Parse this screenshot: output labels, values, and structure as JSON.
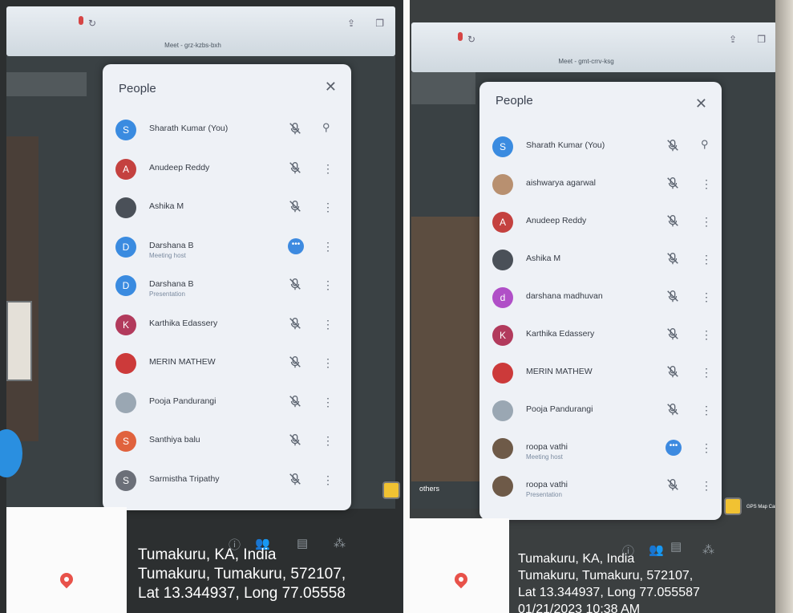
{
  "left": {
    "url": "Meet - grz-kzbs-bxh",
    "panel_title": "People",
    "participants": [
      {
        "name": "Sharath Kumar (You)",
        "initial": "S",
        "color": "#3a8be0",
        "action": "pin"
      },
      {
        "name": "Anudeep Reddy",
        "initial": "A",
        "color": "#c4413f",
        "action": "more"
      },
      {
        "name": "Ashika M",
        "initial": "",
        "color": "#4a5058",
        "action": "more"
      },
      {
        "name": "Darshana B",
        "sub": "Meeting host",
        "initial": "D",
        "color": "#3a8be0",
        "action": "more",
        "speaking": true
      },
      {
        "name": "Darshana B",
        "sub": "Presentation",
        "initial": "D",
        "color": "#3a8be0",
        "action": "more",
        "presenting": true
      },
      {
        "name": "Karthika Edassery",
        "initial": "K",
        "color": "#b23a5c",
        "action": "more"
      },
      {
        "name": "MERIN MATHEW",
        "initial": "",
        "color": "#cc3a3a",
        "action": "more"
      },
      {
        "name": "Pooja Pandurangi",
        "initial": "",
        "color": "#9aa7b3",
        "action": "more"
      },
      {
        "name": "Santhiya balu",
        "initial": "S",
        "color": "#e0623d",
        "action": "more"
      },
      {
        "name": "Sarmistha Tripathy",
        "initial": "S",
        "color": "#6b6f78",
        "action": "more"
      }
    ],
    "gps": [
      "Tumakuru, KA, India",
      "Tumakuru, Tumakuru, 572107,",
      "Lat 13.344937, Long 77.05558"
    ]
  },
  "right": {
    "url": "Meet - gmt-crrv-ksg",
    "panel_title": "People",
    "participants": [
      {
        "name": "Sharath Kumar (You)",
        "initial": "S",
        "color": "#3a8be0",
        "action": "pin"
      },
      {
        "name": "aishwarya agarwal",
        "initial": "",
        "color": "#b89070",
        "action": "more"
      },
      {
        "name": "Anudeep Reddy",
        "initial": "A",
        "color": "#c4413f",
        "action": "more"
      },
      {
        "name": "Ashika M",
        "initial": "",
        "color": "#4a5058",
        "action": "more"
      },
      {
        "name": "darshana madhuvan",
        "initial": "d",
        "color": "#b04fc7",
        "action": "more"
      },
      {
        "name": "Karthika Edassery",
        "initial": "K",
        "color": "#b23a5c",
        "action": "more"
      },
      {
        "name": "MERIN MATHEW",
        "initial": "",
        "color": "#cc3a3a",
        "action": "more"
      },
      {
        "name": "Pooja Pandurangi",
        "initial": "",
        "color": "#9aa7b3",
        "action": "more"
      },
      {
        "name": "roopa vathi",
        "sub": "Meeting host",
        "initial": "",
        "color": "#6e5a48",
        "action": "more",
        "speaking": true
      },
      {
        "name": "roopa vathi",
        "sub": "Presentation",
        "initial": "",
        "color": "#6e5a48",
        "action": "more",
        "presenting": true
      }
    ],
    "gps": [
      "Tumakuru, KA, India",
      "Tumakuru, Tumakuru, 572107,",
      "Lat 13.344937, Long 77.055587",
      "01/21/2023 10:38 AM"
    ],
    "badge_label": "GPS Map Came",
    "tile_label": "others"
  }
}
